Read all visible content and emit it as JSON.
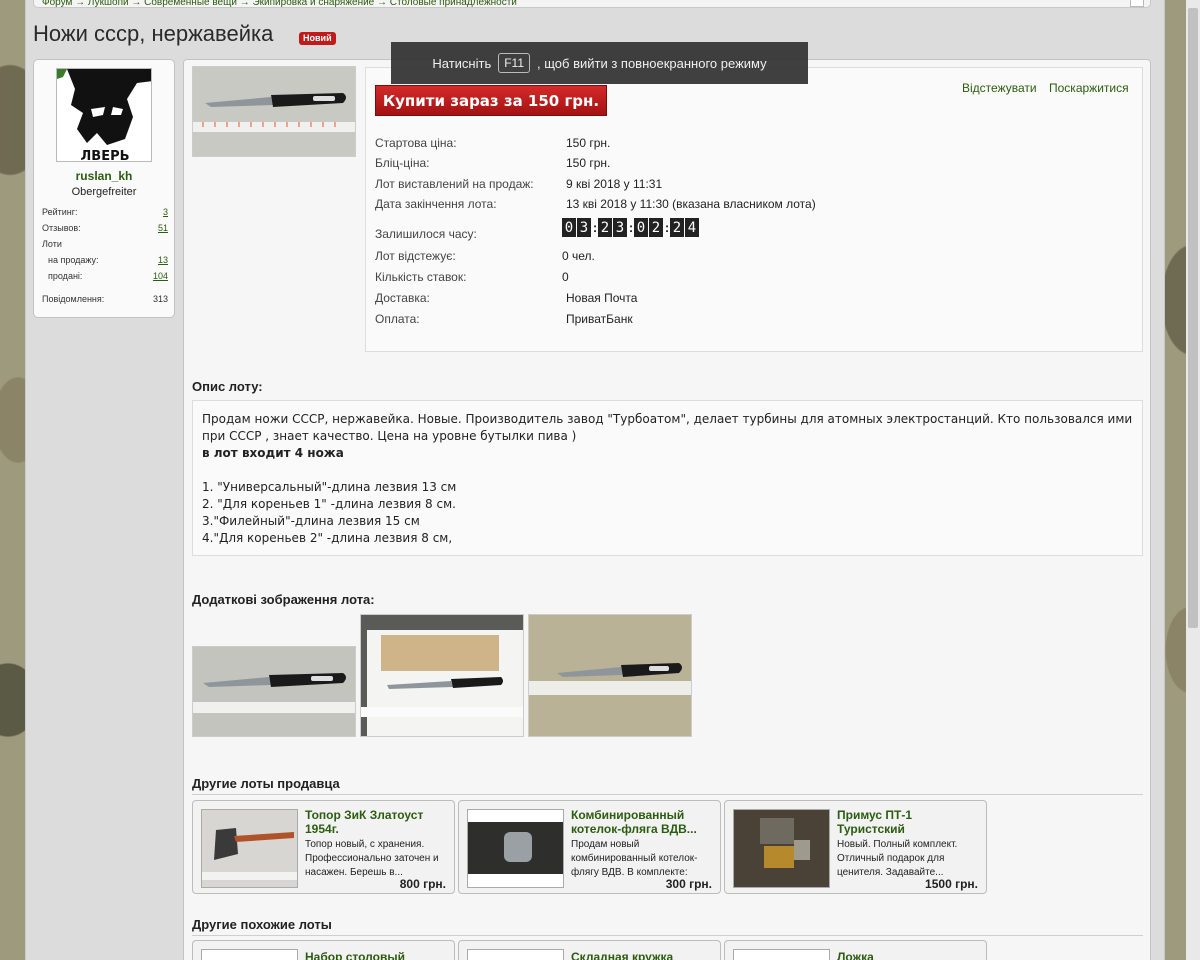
{
  "breadcrumb": "Форум → Лукшопи → Современные вещи → Экипировка и снаряжение → Столовые принадлежности",
  "page": {
    "title": "Ножи ссср, нержавейка",
    "badge": "Новий"
  },
  "fullscreen_tip": {
    "before": "Натисніть",
    "key": "F11",
    "after": ", щоб вийти з повноекранного режиму"
  },
  "seller": {
    "name": "ruslan_kh",
    "rank": "Obergefreiter",
    "avatar_text": "ЛВЕРЬ",
    "stats": [
      {
        "label": "Рейтинг:",
        "value": "3"
      },
      {
        "label": "Отзывов:",
        "value": "51"
      },
      {
        "label": "Лоти",
        "value": ""
      },
      {
        "label": "на продажу:",
        "value": "13"
      },
      {
        "label": "продані:",
        "value": "104"
      },
      {
        "label": "Повідомлення:",
        "value": "313"
      }
    ]
  },
  "lot": {
    "buy_label": "Купити зараз за 150 грн.",
    "watch_link": "Відстежувати",
    "report_link": "Поскаржитися",
    "fields": [
      {
        "label": "Стартова ціна:",
        "value": "150 грн."
      },
      {
        "label": "Бліц-ціна:",
        "value": "150 грн."
      },
      {
        "label": "Лот виставлений на продаж:",
        "value": "9 кві 2018 у 11:31"
      },
      {
        "label": "Дата закінчення лота:",
        "value": "13 кві 2018 у 11:30 (вказана власником лота)"
      },
      {
        "label": "Залишилося часу:",
        "value": ""
      },
      {
        "label": "Лот відстежує:",
        "value": "0 чел."
      },
      {
        "label": "Кількість ставок:",
        "value": "0"
      },
      {
        "label": "Доставка:",
        "value": "Новая Почта"
      },
      {
        "label": "Оплата:",
        "value": "ПриватБанк"
      }
    ],
    "countdown": [
      "03",
      "23",
      "02",
      "24"
    ]
  },
  "description": {
    "heading": "Опис лоту:",
    "text": "Продам ножи СССР, нержавейка. Новые. Производитель завод \"Турбоатом\", делает турбины для атомных электростанций. Кто пользовался ими при СССР , знает качество. Цена на уровне бутылки пива )",
    "bold_line": "в лот входит 4 ножа",
    "items": [
      "1. \"Универсальный\"-длина лезвия 13 см",
      "2. \"Для кореньев 1\" -длина лезвия 8 см.",
      "3.\"Филейный\"-длина лезвия 15 см",
      "4.\"Для кореньев 2\" -длина лезвия 8 см,"
    ]
  },
  "gallery": {
    "heading": "Додаткові зображення лота:"
  },
  "other_lots": {
    "heading": "Другие лоты продавца",
    "items": [
      {
        "title": "Топор ЗиК Златоуст 1954г.",
        "desc": "Топор новый, с хранения. Профессионально заточен и насажен. Берешь в...",
        "price": "800 грн."
      },
      {
        "title": "Комбинированный котелок-фляга ВДВ...",
        "desc": "Продам новый комбинированный котелок-флягу ВДВ. В комплекте: чехол,...",
        "price": "300 грн."
      },
      {
        "title": "Примус ПТ-1 Туристский",
        "desc": "Новый. Полный комплект. Отличный подарок для ценителя. Задавайте...",
        "price": "1500 грн."
      }
    ]
  },
  "similar_lots": {
    "heading": "Другие похожие лоты",
    "items": [
      {
        "title": "Набор столовый"
      },
      {
        "title": "Складная кружка"
      },
      {
        "title": "Ложка"
      }
    ]
  }
}
